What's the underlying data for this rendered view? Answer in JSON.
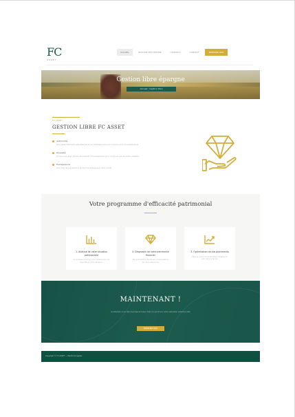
{
  "header": {
    "logo": {
      "mark": "FC",
      "sub": "ASSET"
    },
    "nav": [
      "ACCUEIL",
      "GESTION DE FORTUNE",
      "CONSEILS",
      "CONTACT"
    ],
    "nav_active_index": 0,
    "cta": "PRENDRE RDV"
  },
  "hero": {
    "title": "Gestion libre épargne",
    "breadcrumb": "Accueil › Gestion libre"
  },
  "content": {
    "kicker": "FC ASSET",
    "title": "GESTION LIBRE FC ASSET",
    "features": [
      {
        "title": "Autonomie",
        "text": "Vous gérez librement votre épargne et vos arbitrages selon vos propres choix d'investissement."
      },
      {
        "title": "Diversité",
        "text": "Accès à une large gamme de supports d'investissement pour construire une allocation adaptée."
      },
      {
        "title": "Transparence",
        "text": "Suivi clair de vos positions et des frais appliqués à votre contrat."
      }
    ]
  },
  "program": {
    "title": "Votre programme d'efficacité patrimonial",
    "cards": [
      {
        "icon": "bar-chart-icon",
        "title": "1. Analyse de votre situation patrimoniale",
        "text": "Un premier échange pour comprendre vos objectifs et votre situation."
      },
      {
        "icon": "diamond-icon",
        "title": "2. Diagnostic de votre patrimoine financier",
        "text": "Nous identifions les leviers d'optimisation de votre patrimoine."
      },
      {
        "icon": "line-chart-icon",
        "title": "3. Optimisation de vos placements",
        "text": "Mise en place d'une stratégie adaptée et suivi dans le temps."
      }
    ]
  },
  "cta": {
    "title": "MAINTENANT !",
    "text": "Contactez-nous dès maintenant pour faire le point sur votre situation patrimoniale",
    "button": "PRENDRE RDV"
  },
  "footer": {
    "text": "Copyright © FC ASSET — Mentions légales"
  },
  "colors": {
    "green": "#1d5a4c",
    "gold": "#d3ad3a",
    "light_bg": "#f6f6f4"
  }
}
